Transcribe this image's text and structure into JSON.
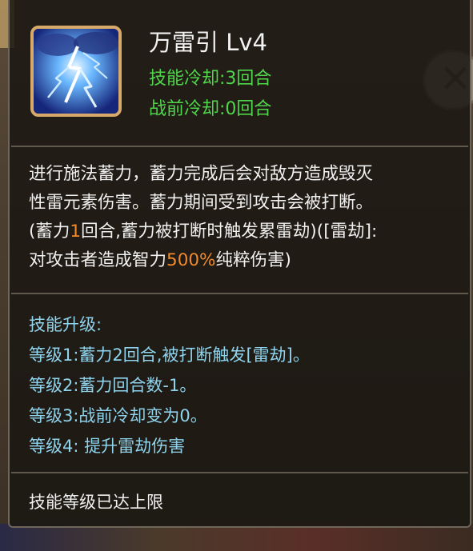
{
  "skill": {
    "name": "万雷引",
    "level": "Lv4",
    "cooldown": "技能冷却:3回合",
    "pre_battle_cooldown": "战前冷却:0回合",
    "icon": "lightning-icon"
  },
  "description": {
    "line1": "进行施法蓄力，蓄力完成后会对敌方造成毁灭",
    "line2": "性雷元素伤害。蓄力期间受到攻击会被打断。",
    "line3_a": "(蓄力",
    "line3_num": "1",
    "line3_b": "回合,蓄力被打断时触发累雷劫)([雷劫]:",
    "line4_a": "对攻击者造成智力",
    "line4_pct": "500%",
    "line4_b": "纯粹伤害)"
  },
  "upgrade": {
    "title": "技能升级:",
    "levels": [
      "等级1:蓄力2回合,被打断触发[雷劫]。",
      "等级2:蓄力回合数-1。",
      "等级3:战前冷却变为0。",
      "等级4: 提升雷劫伤害"
    ]
  },
  "status": "技能等级已达上限",
  "colors": {
    "cooldown_green": "#4fd64a",
    "highlight_orange": "#f08a2a",
    "upgrade_blue": "#8fd3ec",
    "icon_border": "#d7a96a"
  }
}
